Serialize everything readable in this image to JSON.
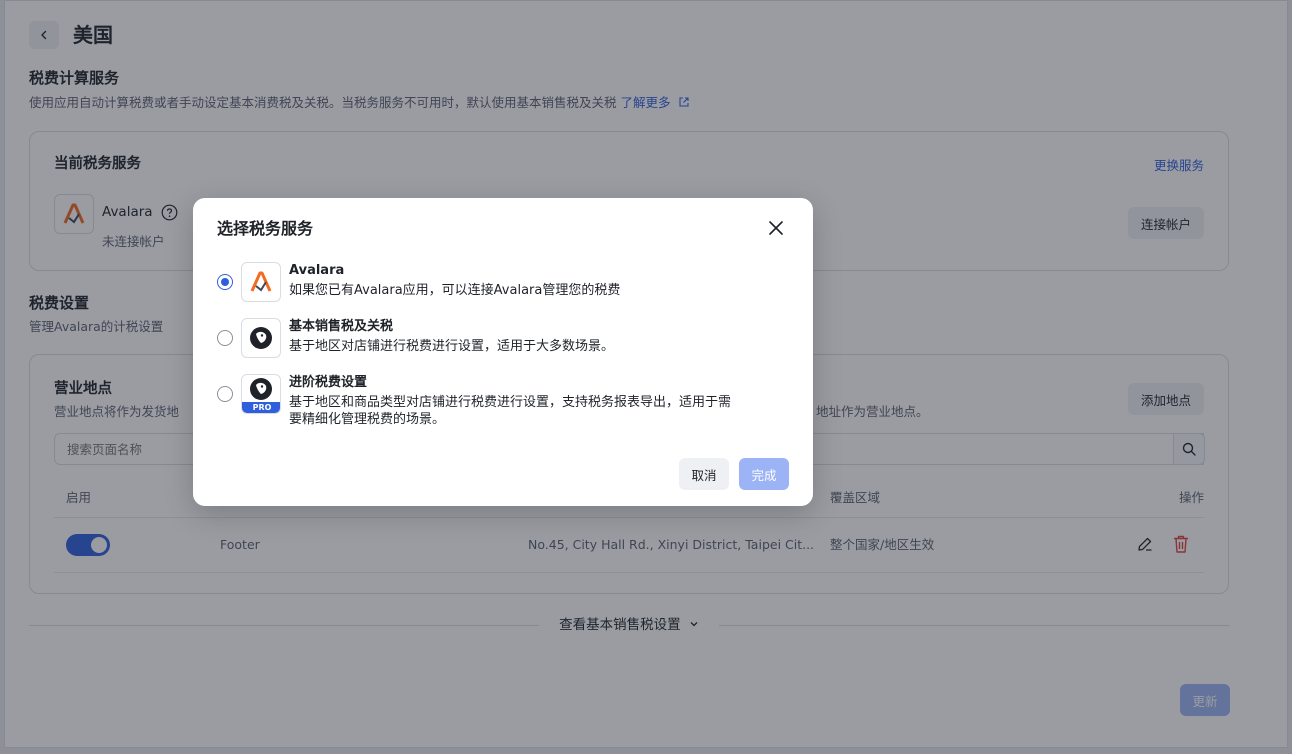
{
  "header": {
    "title": "美国"
  },
  "tax_service_section": {
    "title": "税费计算服务",
    "description": "使用应用自动计算税费或者手动设定基本消费税及关税。当税务服务不可用时，默认使用基本销售税及关税",
    "learn_more": "了解更多",
    "current": {
      "title": "当前税务服务",
      "change_link": "更换服务",
      "provider_name": "Avalara",
      "provider_status": "未连接帐户",
      "connect_button": "连接帐户"
    }
  },
  "tax_settings_section": {
    "title": "税费设置",
    "description": "管理Avalara的计税设置"
  },
  "business_locations": {
    "title": "营业地点",
    "description_left": "营业地点将作为发货地",
    "description_right": "地址作为营业地点。",
    "add_button": "添加地点",
    "search_placeholder": "搜索页面名称",
    "columns": {
      "enabled": "启用",
      "coverage": "覆盖区域",
      "actions": "操作"
    },
    "rows": [
      {
        "enabled": true,
        "name": "Footer",
        "address": "No.45, City Hall Rd., Xinyi District, Taipei Cit...",
        "coverage": "整个国家/地区生效"
      }
    ]
  },
  "footer": {
    "view_basic": "查看基本销售税设置",
    "update_button": "更新"
  },
  "modal": {
    "title": "选择税务服务",
    "options": [
      {
        "title": "Avalara",
        "description": "如果您已有Avalara应用，可以连接Avalara管理您的税费",
        "selected": true,
        "icon": "avalara-logo-icon"
      },
      {
        "title": "基本销售税及关税",
        "description": "基于地区对店铺进行税费进行设置，适用于大多数场景。",
        "selected": false,
        "icon": "bird-logo-icon"
      },
      {
        "title": "进阶税费设置",
        "description_line1": "基于地区和商品类型对店铺进行税费进行设置，支持税务报表导出，适用于需",
        "description_line2": "要精细化管理税费的场景。",
        "badge": "PRO",
        "selected": false,
        "icon": "bird-pro-logo-icon"
      }
    ],
    "cancel_button": "取消",
    "confirm_button": "完成"
  },
  "colors": {
    "primary": "#2f5fdc",
    "primary_disabled": "#9cb4f5",
    "delete": "#e0443a",
    "avalara_orange": "#f26b21"
  }
}
